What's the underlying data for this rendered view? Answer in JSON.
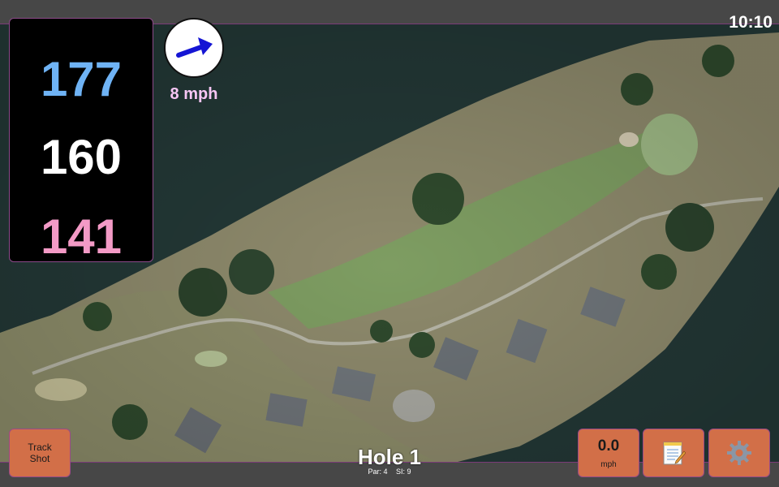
{
  "status": {
    "time": "10:10"
  },
  "yardage": {
    "back": "177",
    "middle": "160",
    "front": "141"
  },
  "wind": {
    "speed": "8 mph",
    "icon": "wind-direction-arrow-icon"
  },
  "controls": {
    "track_line1": "Track",
    "track_line2": "Shot",
    "speed_value": "0.0",
    "speed_unit": "mph",
    "notes_icon": "notepad-icon",
    "settings_icon": "gear-icon"
  },
  "hole": {
    "title": "Hole 1",
    "par_label": "Par: 4",
    "si_label": "SI: 9"
  },
  "colors": {
    "back_yardage": "#6fb3f5",
    "middle_yardage": "#ffffff",
    "front_yardage": "#f39ac6",
    "button": "#d26f48",
    "accent_border": "#8d4a8a"
  }
}
